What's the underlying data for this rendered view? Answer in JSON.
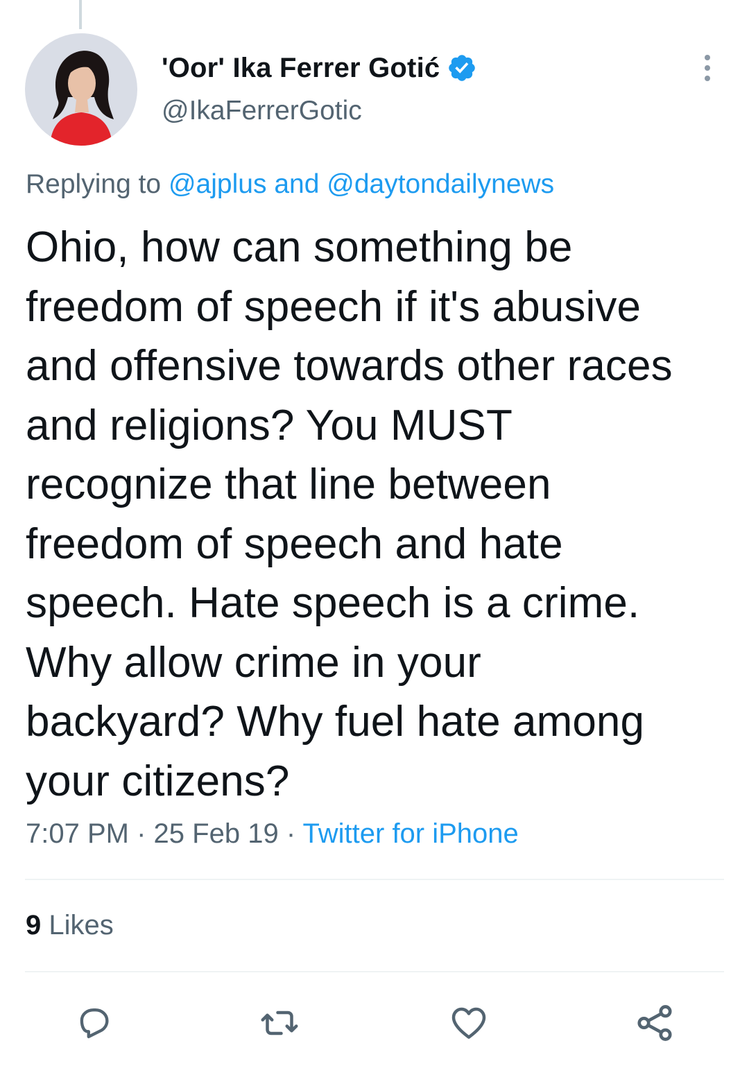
{
  "tweet": {
    "author": {
      "display_name": "'Oor' Ika Ferrer Gotić",
      "handle": "@IkaFerrerGotic",
      "verified": true
    },
    "replying": {
      "prefix": "Replying to",
      "mention_1": "@ajplus",
      "conjunction": "and",
      "mention_2": "@daytondailynews"
    },
    "text_lines": [
      "Ohio, how can something be",
      "freedom of speech if it's abusive",
      "and offensive towards other races",
      "and religions? You MUST",
      "recognize that line between",
      "freedom of speech and hate",
      "speech. Hate speech is a crime.",
      "Why allow crime in your",
      "backyard? Why fuel hate among",
      "your citizens?"
    ],
    "time": "7:07 PM",
    "date": "25 Feb 19",
    "source": "Twitter for iPhone",
    "separator": "·",
    "likes_count": "9",
    "likes_label": "Likes"
  },
  "icons": {
    "more": "more-vertical-icon",
    "verified": "verified-badge-icon",
    "reply": "reply-icon",
    "retweet": "retweet-icon",
    "like": "heart-icon",
    "share": "share-icon"
  },
  "colors": {
    "link": "#1d9bf0",
    "secondary_text": "#536471",
    "primary_text": "#0f1419",
    "divider": "#eff3f4"
  }
}
